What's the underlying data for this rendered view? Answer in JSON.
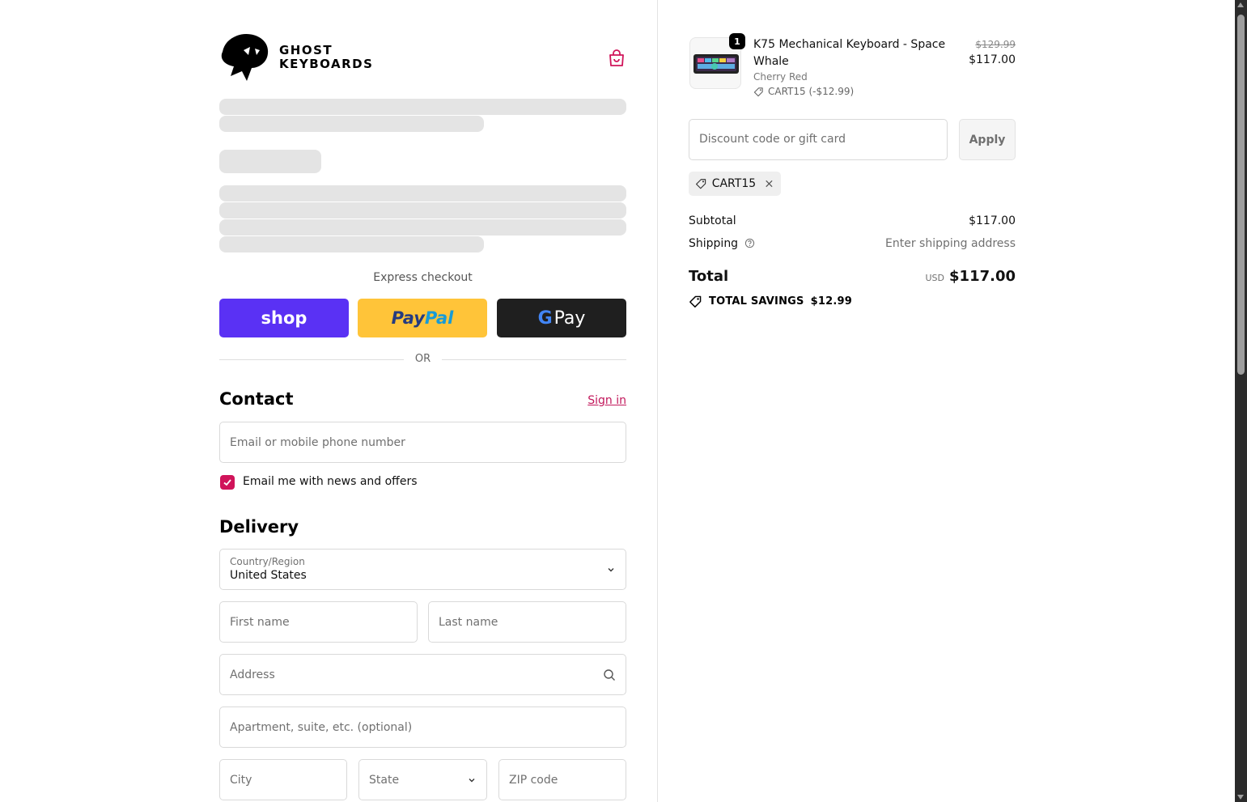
{
  "brand": {
    "name_line1": "GHOST",
    "name_line2": "KEYBOARDS"
  },
  "express": {
    "label": "Express checkout",
    "shop_label": "shop",
    "paypal_part1": "Pay",
    "paypal_part2": "Pal",
    "gpay_g": "G",
    "gpay_label": "Pay",
    "or_label": "OR"
  },
  "contact": {
    "title": "Contact",
    "signin_label": "Sign in",
    "email_placeholder": "Email or mobile phone number",
    "newsletter_label": "Email me with news and offers",
    "newsletter_checked": true
  },
  "delivery": {
    "title": "Delivery",
    "country_label": "Country/Region",
    "country_value": "United States",
    "first_name_placeholder": "First name",
    "last_name_placeholder": "Last name",
    "address_placeholder": "Address",
    "apartment_placeholder": "Apartment, suite, etc. (optional)",
    "city_placeholder": "City",
    "state_placeholder": "State",
    "zip_placeholder": "ZIP code"
  },
  "order": {
    "item": {
      "quantity": "1",
      "name": "K75 Mechanical Keyboard - Space Whale",
      "variant": "Cherry Red",
      "discount": "CART15 (-$12.99)",
      "price_original": "$129.99",
      "price_final": "$117.00"
    },
    "discount_placeholder": "Discount code or gift card",
    "apply_label": "Apply",
    "applied_code": "CART15",
    "subtotal_label": "Subtotal",
    "subtotal_value": "$117.00",
    "shipping_label": "Shipping",
    "shipping_value": "Enter shipping address",
    "total_label": "Total",
    "currency": "USD",
    "total_value": "$117.00",
    "savings_label": "TOTAL SAVINGS",
    "savings_value": "$12.99"
  },
  "colors": {
    "accent": "#d0145a",
    "shop_pay": "#5a31f4",
    "paypal": "#ffc439",
    "gpay": "#1f1f1f"
  }
}
